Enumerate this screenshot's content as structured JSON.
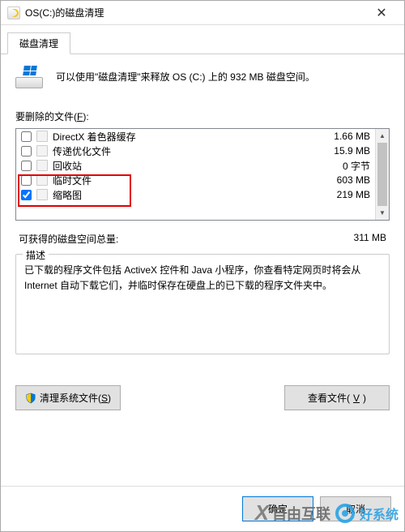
{
  "window": {
    "title": "OS(C:)的磁盘清理",
    "close": "✕"
  },
  "tabs": {
    "active": "磁盘清理"
  },
  "intro": "可以使用\"磁盘清理\"来释放 OS (C:) 上的 932 MB 磁盘空间。",
  "files_label": {
    "pre": "要删除的文件(",
    "key": "F",
    "post": "):"
  },
  "files": [
    {
      "name": "DirectX 着色器缓存",
      "size": "1.66 MB",
      "checked": false
    },
    {
      "name": "传递优化文件",
      "size": "15.9 MB",
      "checked": false
    },
    {
      "name": "回收站",
      "size": "0 字节",
      "checked": false
    },
    {
      "name": "临时文件",
      "size": "603 MB",
      "checked": false
    },
    {
      "name": "缩略图",
      "size": "219 MB",
      "checked": true
    }
  ],
  "total": {
    "label": "可获得的磁盘空间总量:",
    "value": "311 MB"
  },
  "desc": {
    "legend": "描述",
    "text": "已下载的程序文件包括 ActiveX 控件和 Java 小程序，你查看特定网页时将会从 Internet 自动下载它们，并临时保存在硬盘上的已下载的程序文件夹中。"
  },
  "buttons": {
    "sys_pre": "清理系统文件(",
    "sys_key": "S",
    "sys_post": ")",
    "view_pre": "查看文件(",
    "view_key": "V",
    "view_post": ")",
    "ok": "确定",
    "cancel": "取消"
  },
  "watermark": {
    "x": "X",
    "t1": "自由互联",
    "t2": "好系统"
  }
}
